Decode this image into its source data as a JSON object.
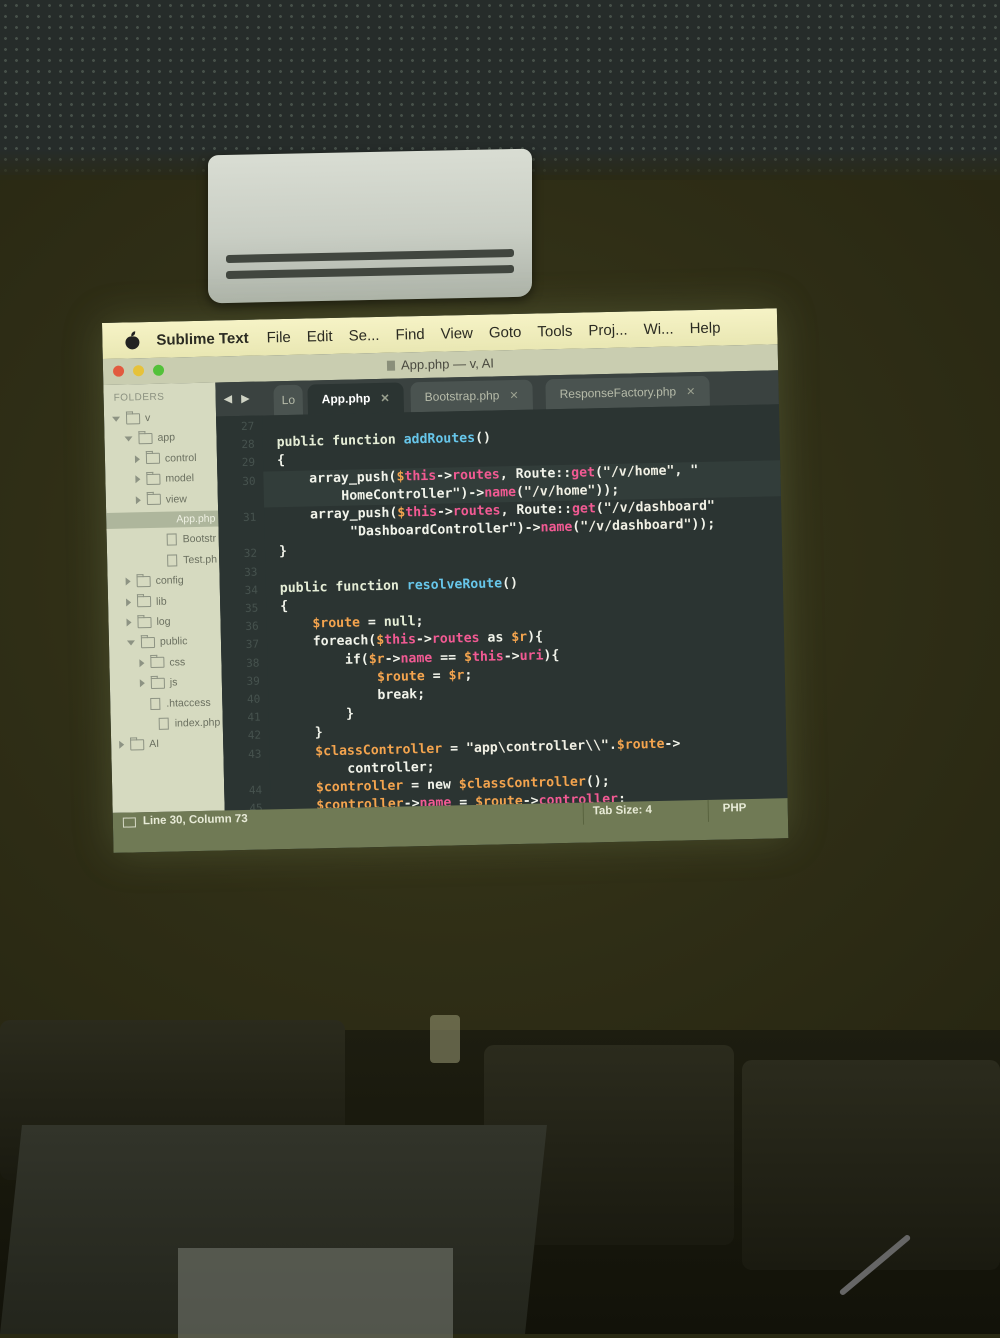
{
  "menubar": {
    "app_name": "Sublime Text",
    "items": [
      "File",
      "Edit",
      "Se...",
      "Find",
      "View",
      "Goto",
      "Tools",
      "Proj...",
      "Wi...",
      "Help"
    ]
  },
  "window": {
    "title": "App.php — v, AI"
  },
  "sidebar": {
    "header": "FOLDERS",
    "rows": [
      {
        "label": "v",
        "kind": "folder-open"
      },
      {
        "label": "app",
        "kind": "folder-open"
      },
      {
        "label": "control",
        "kind": "folder"
      },
      {
        "label": "model",
        "kind": "folder"
      },
      {
        "label": "view",
        "kind": "folder"
      },
      {
        "label": "App.php",
        "kind": "file-selected"
      },
      {
        "label": "Bootstr",
        "kind": "file"
      },
      {
        "label": "Test.ph",
        "kind": "file"
      },
      {
        "label": "config",
        "kind": "folder"
      },
      {
        "label": "lib",
        "kind": "folder"
      },
      {
        "label": "log",
        "kind": "folder"
      },
      {
        "label": "public",
        "kind": "folder-open"
      },
      {
        "label": "css",
        "kind": "folder"
      },
      {
        "label": "js",
        "kind": "folder"
      },
      {
        "label": ".htaccess",
        "kind": "file"
      },
      {
        "label": "index.php",
        "kind": "file"
      },
      {
        "label": "AI",
        "kind": "folder"
      }
    ]
  },
  "tabs": [
    {
      "label": "Lo",
      "active": false
    },
    {
      "label": "App.php",
      "active": true
    },
    {
      "label": "Bootstrap.php",
      "active": false
    },
    {
      "label": "ResponseFactory.php",
      "active": false
    }
  ],
  "editor": {
    "lines": [
      {
        "num": "27",
        "html": ""
      },
      {
        "num": "28",
        "html": "<span class='kw'>public function</span> <span class='fn'>addRoutes</span>()"
      },
      {
        "num": "29",
        "html": "{"
      },
      {
        "num": "30",
        "html": "    array_push(<span class='var'>$</span><span class='this'>this</span>-><span class='op'>routes</span>, Route::<span class='op'>get</span>(<span class='str'>\"/v/home\"</span>, \""
      },
      {
        "num": "",
        "html": "        HomeController\")-><span class='op'>name</span>(<span class='str'>\"/v/home\"</span>));"
      },
      {
        "num": "31",
        "html": "    array_push(<span class='var'>$</span><span class='this'>this</span>-><span class='op'>routes</span>, Route::<span class='op'>get</span>(<span class='str'>\"/v/dashboard\"</span>"
      },
      {
        "num": "",
        "html": "         \"DashboardController\")-><span class='op'>name</span>(<span class='str'>\"/v/dashboard\"</span>));"
      },
      {
        "num": "32",
        "html": "}"
      },
      {
        "num": "33",
        "html": ""
      },
      {
        "num": "34",
        "html": "<span class='kw'>public function</span> <span class='fn'>resolveRoute</span>()"
      },
      {
        "num": "35",
        "html": "{"
      },
      {
        "num": "36",
        "html": "    <span class='var'>$route</span> = <span class='kw'>null</span>;"
      },
      {
        "num": "37",
        "html": "    foreach(<span class='var'>$</span><span class='this'>this</span>-><span class='op'>routes</span> as <span class='var'>$r</span>){"
      },
      {
        "num": "38",
        "html": "        if(<span class='var'>$r</span>-><span class='op'>name</span> == <span class='var'>$</span><span class='this'>this</span>-><span class='op'>uri</span>){"
      },
      {
        "num": "39",
        "html": "            <span class='var'>$route</span> = <span class='var'>$r</span>;"
      },
      {
        "num": "40",
        "html": "            break;"
      },
      {
        "num": "41",
        "html": "        }"
      },
      {
        "num": "42",
        "html": "    }"
      },
      {
        "num": "43",
        "html": "    <span class='var'>$classController</span> = <span class='str'>\"app\\controller\\\\\"</span>.<span class='var'>$route</span>->"
      },
      {
        "num": "",
        "html": "        controller;"
      },
      {
        "num": "44",
        "html": "    <span class='var'>$controller</span> = new <span class='var'>$classController</span>();"
      },
      {
        "num": "45",
        "html": "    <span class='var'>$controller</span>-><span class='op'>name</span> = <span class='var'>$route</span>-><span class='op'>controller</span>;"
      }
    ]
  },
  "status": {
    "position": "Line 30, Column 73",
    "tab_size": "Tab Size: 4",
    "syntax": "PHP"
  }
}
